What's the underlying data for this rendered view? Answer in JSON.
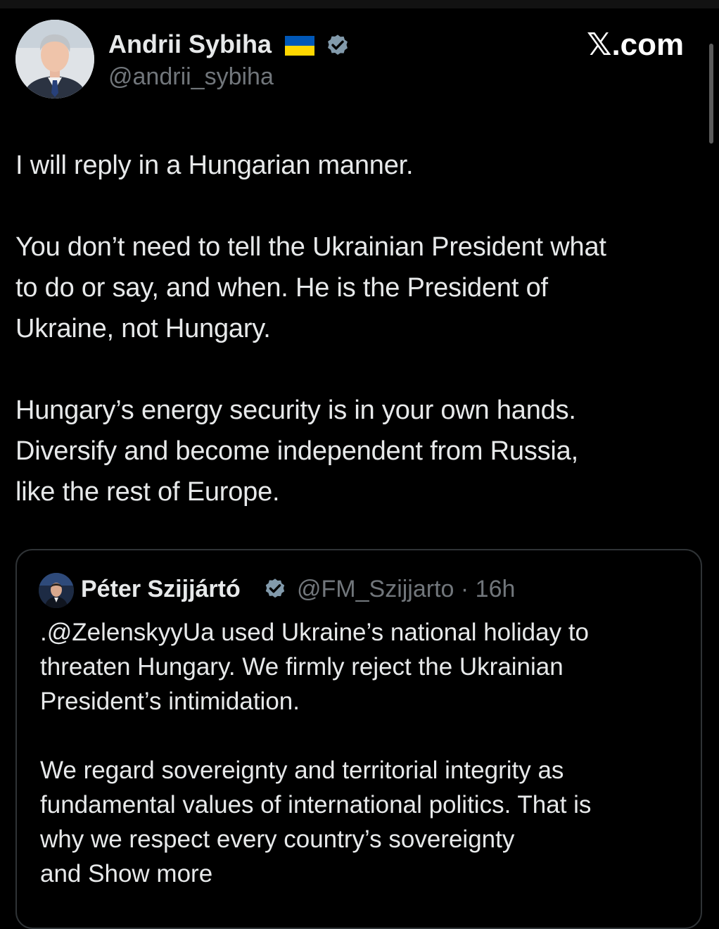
{
  "tweet": {
    "author": {
      "name": "Andrii Sybiha",
      "handle": "@andrii_sybiha",
      "flag_icon": "ukraine-flag-icon",
      "verified_icon": "verified-badge-icon"
    },
    "source_label": "𝕏.com",
    "paragraphs": [
      [
        "I will reply in a Hungarian manner."
      ],
      [
        "You don’t need to tell the Ukrainian President what",
        "to do or say, and when. He is the President of",
        "Ukraine, not Hungary."
      ],
      [
        "Hungary’s energy security is in your own hands.",
        "Diversify and become independent from Russia,",
        "like the rest of Europe."
      ]
    ]
  },
  "quoted_tweet": {
    "author": {
      "name": "Péter Szijjártó",
      "handle_time": "@FM_Szijjarto · 16h",
      "verified_icon": "verified-badge-icon"
    },
    "paragraphs": [
      [
        ".@ZelenskyyUa used Ukraine’s national holiday to",
        "threaten Hungary. We firmly reject the Ukrainian",
        "President’s intimidation."
      ],
      [
        "We regard sovereignty and territorial integrity as",
        "fundamental values of international politics. That is",
        "why we respect every country’s sovereignty"
      ]
    ],
    "truncated_last_word": "and",
    "show_more_label": "Show more"
  },
  "colors": {
    "background": "#000000",
    "text": "#e7e9ea",
    "secondary_text": "#71767b",
    "verified": "#829aab",
    "border": "#2f3336",
    "flag_blue": "#0057b7",
    "flag_yellow": "#ffd700"
  }
}
